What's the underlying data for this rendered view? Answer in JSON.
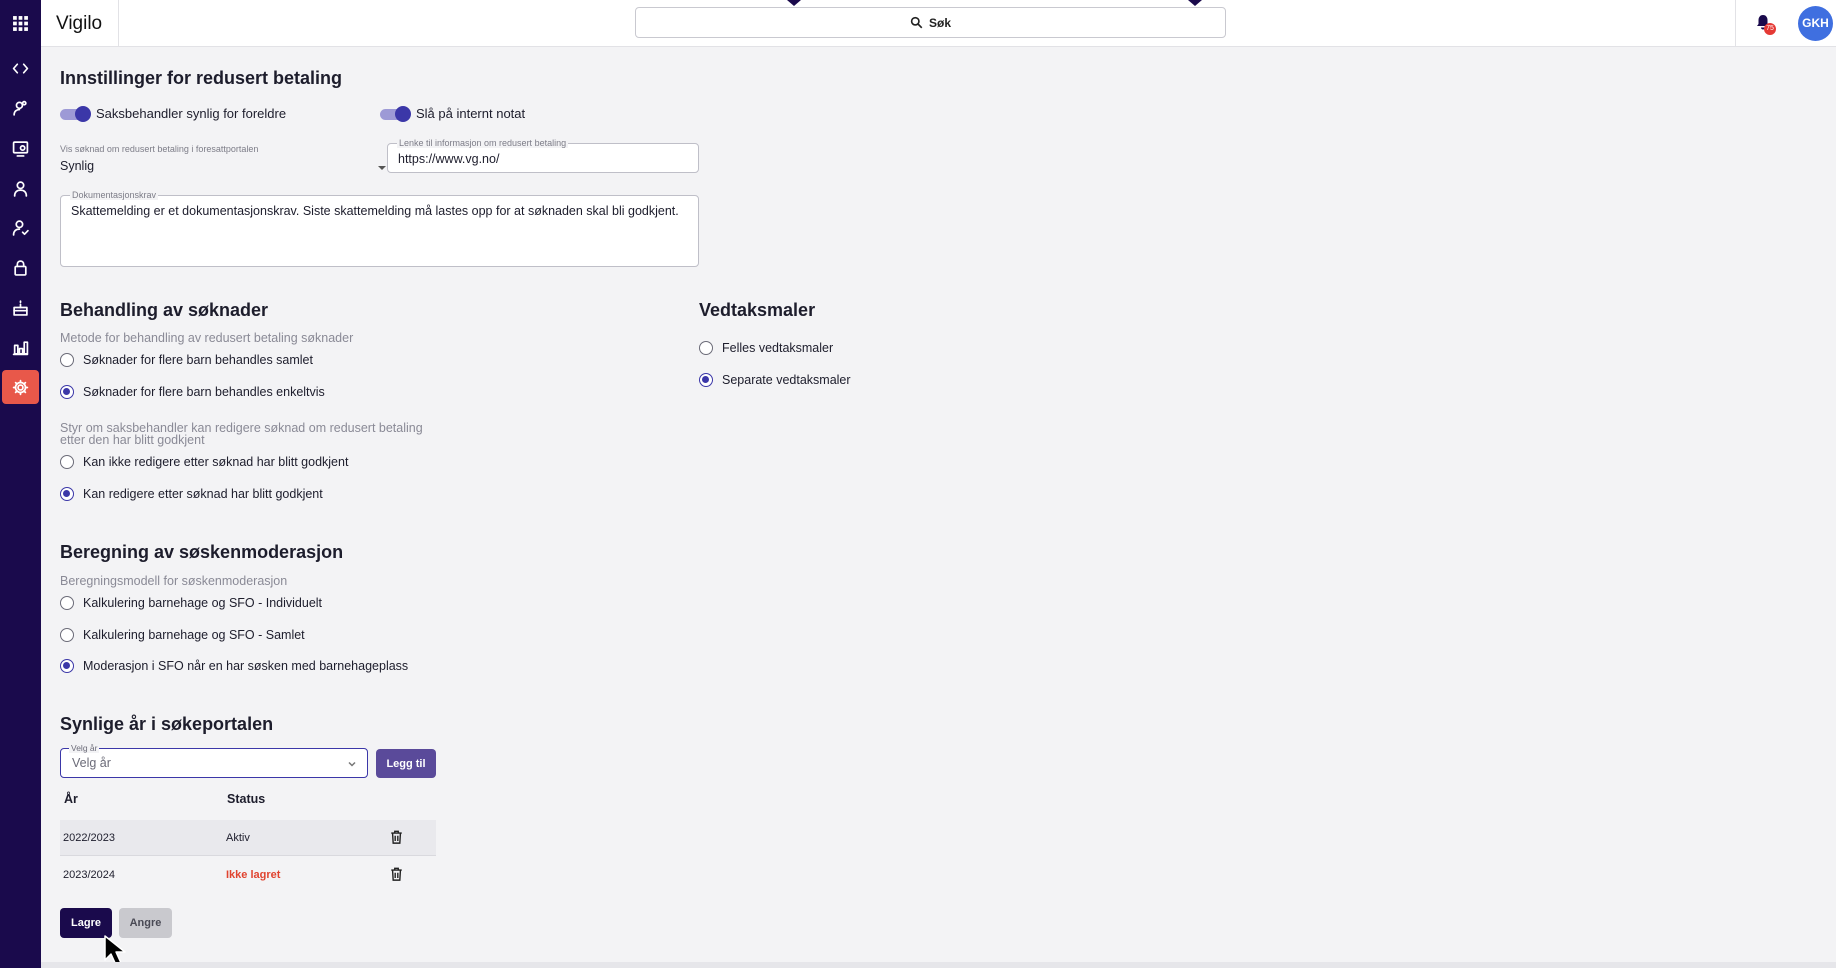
{
  "app": {
    "title": "Vigilo"
  },
  "header": {
    "search_label": "Søk",
    "notification_count": "75",
    "avatar_initials": "GKH"
  },
  "sidebar": {
    "items": [
      {
        "icon": "apps-grid-icon"
      },
      {
        "icon": "code-icon"
      },
      {
        "icon": "user-search-icon"
      },
      {
        "icon": "monitor-settings-icon"
      },
      {
        "icon": "person-icon"
      },
      {
        "icon": "user-check-icon"
      },
      {
        "icon": "lock-icon"
      },
      {
        "icon": "cake-icon"
      },
      {
        "icon": "bar-chart-icon"
      },
      {
        "icon": "gear-icon",
        "active": true
      }
    ]
  },
  "settings": {
    "title": "Innstillinger for redusert betaling",
    "toggle_parents": "Saksbehandler synlig for foreldre",
    "toggle_note": "Slå på internt notat",
    "visibility_label": "Vis søknad om redusert betaling i foresattportalen",
    "visibility_value": "Synlig",
    "link_label": "Lenke til informasjon om redusert betaling",
    "link_value": "https://www.vg.no/",
    "doc_label": "Dokumentasjonskrav",
    "doc_value": "Skattemelding er et dokumentasjonskrav. Siste skattemelding må lastes opp for at søknaden skal bli godkjent."
  },
  "processing": {
    "title": "Behandling av søknader",
    "method_label": "Metode for behandling av redusert betaling søknader",
    "method_options": [
      {
        "label": "Søknader for flere barn behandles samlet",
        "checked": false
      },
      {
        "label": "Søknader for flere barn behandles enkeltvis",
        "checked": true
      }
    ],
    "edit_label": "Styr om saksbehandler kan redigere søknad om redusert betaling etter den har blitt godkjent",
    "edit_options": [
      {
        "label": "Kan ikke redigere etter søknad har blitt godkjent",
        "checked": false
      },
      {
        "label": "Kan redigere etter søknad har blitt godkjent",
        "checked": true
      }
    ]
  },
  "templates": {
    "title": "Vedtaksmaler",
    "options": [
      {
        "label": "Felles vedtaksmaler",
        "checked": false
      },
      {
        "label": "Separate vedtaksmaler",
        "checked": true
      }
    ]
  },
  "sibling": {
    "title": "Beregning av søskenmoderasjon",
    "model_label": "Beregningsmodell for søskenmoderasjon",
    "options": [
      {
        "label": "Kalkulering barnehage og SFO - Individuelt",
        "checked": false
      },
      {
        "label": "Kalkulering barnehage og SFO - Samlet",
        "checked": false
      },
      {
        "label": "Moderasjon i SFO når en har søsken med barnehageplass",
        "checked": true
      }
    ]
  },
  "years": {
    "title": "Synlige år i søkeportalen",
    "select_label": "Velg år",
    "select_placeholder": "Velg år",
    "add_button": "Legg til",
    "columns": [
      "År",
      "Status"
    ],
    "rows": [
      {
        "year": "2022/2023",
        "status": "Aktiv"
      },
      {
        "year": "2023/2024",
        "status": "Ikke lagret"
      }
    ]
  },
  "actions": {
    "save": "Lagre",
    "cancel": "Angre"
  },
  "colors": {
    "sidebar": "#1a0a4c",
    "accent": "#3b37a8",
    "active_nav": "#e8584a",
    "warning": "#e0432f"
  }
}
